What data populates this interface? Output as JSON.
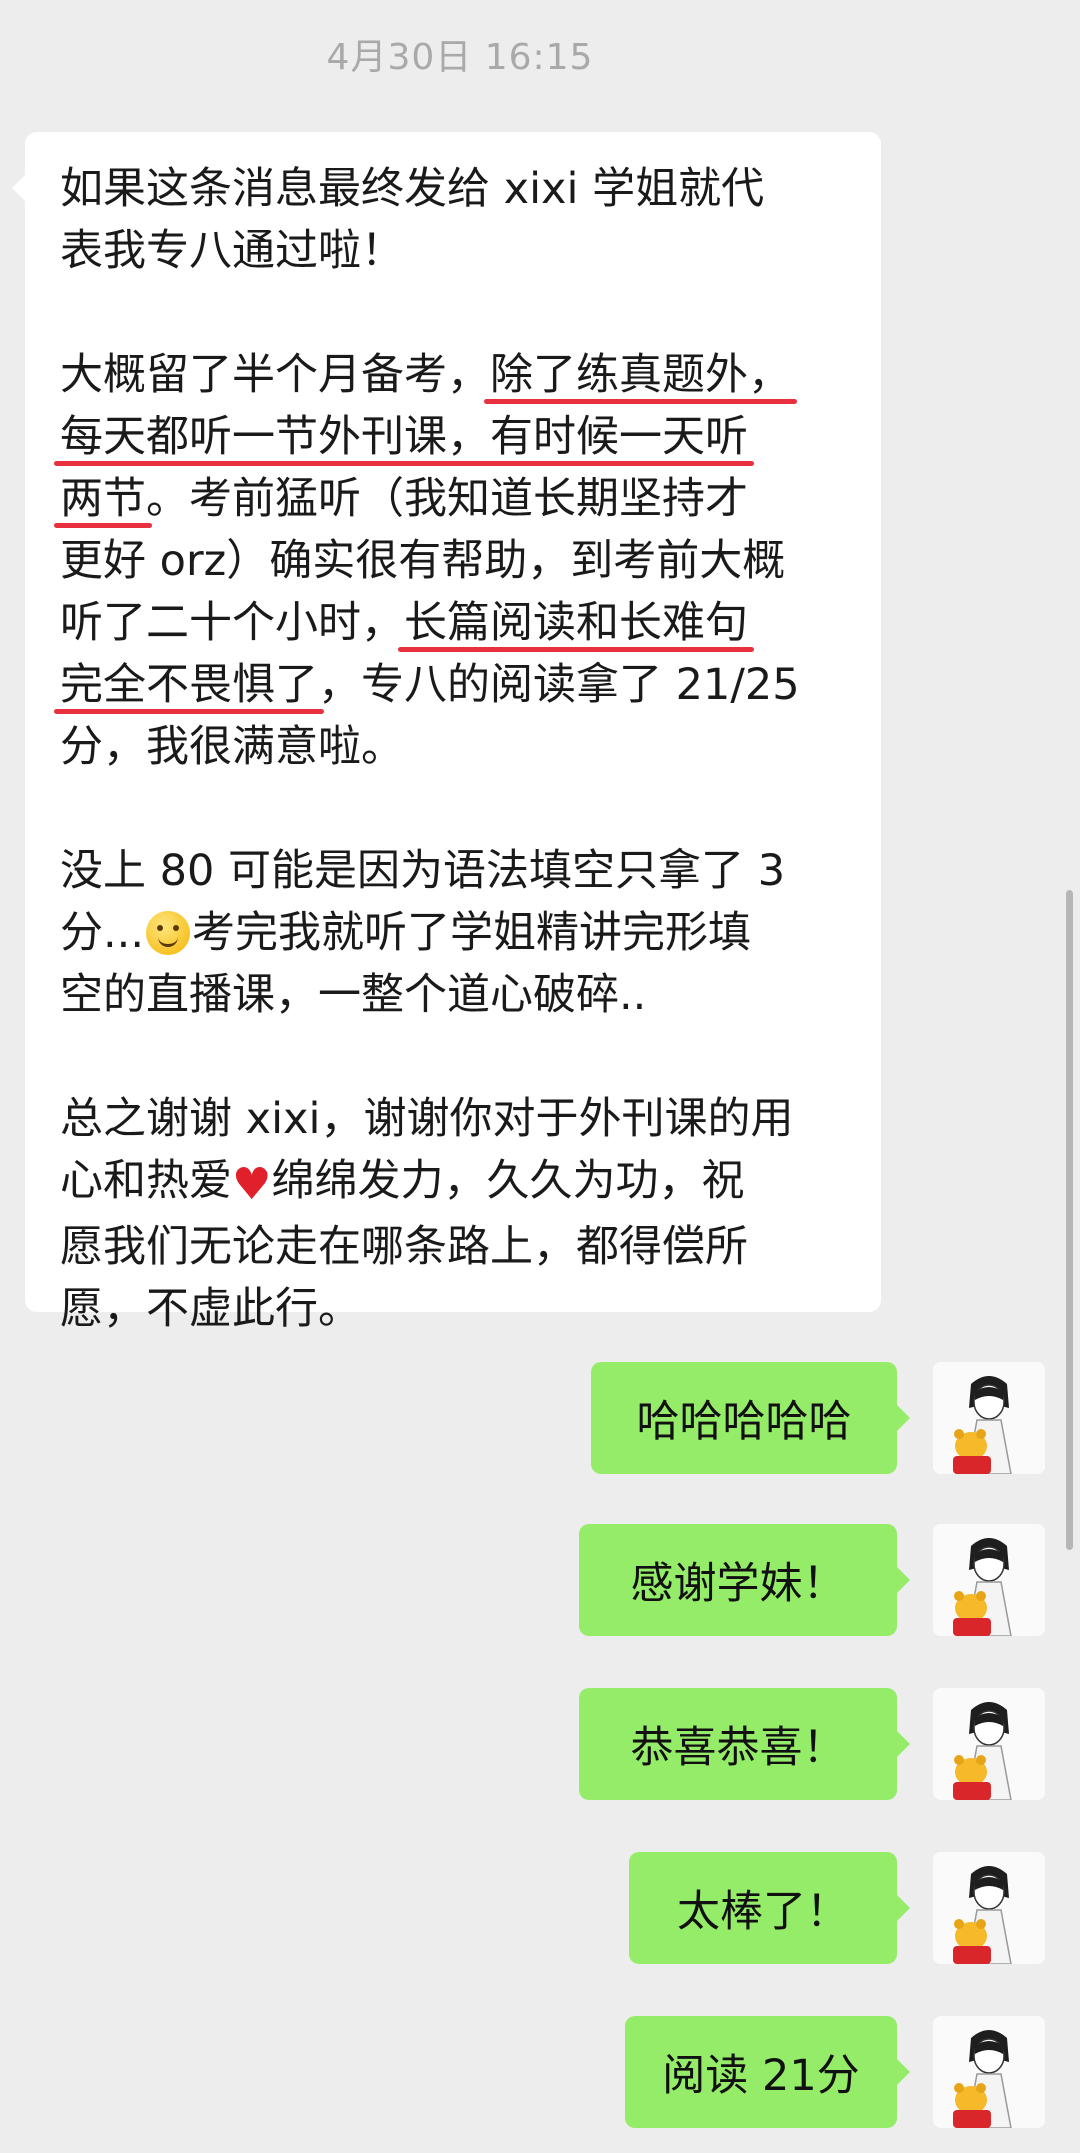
{
  "timestamp": "4月30日 16:15",
  "incoming": {
    "p1": {
      "l1": "如果这条消息最终发给 xixi 学姐就代",
      "l2": "表我专八通过啦！"
    },
    "p2": {
      "l1a": "大概留了半个月备考，",
      "l1b": "除了练真题外，",
      "l2": "每天都听一节外刊课，有时候一天听",
      "l3a": "两节",
      "l3b": "。考前猛听（我知道长期坚持才",
      "l4": "更好 orz）确实很有帮助，到考前大概",
      "l5a": "听了二十个小时，",
      "l5b": "长篇阅读和长难句",
      "l6a": "完全不畏惧了",
      "l6b": "，专八的阅读拿了 21/25",
      "l7": "分，我很满意啦。"
    },
    "p3": {
      "l1": "没上 80 可能是因为语法填空只拿了 3",
      "l2a": "分...",
      "l2b": "考完我就听了学姐精讲完形填",
      "l3": "空的直播课，一整个道心破碎.."
    },
    "p4": {
      "l1": "总之谢谢 xixi，谢谢你对于外刊课的用",
      "l2a": "心和热爱",
      "l2b": "绵绵发力，久久为功，祝",
      "l3": "愿我们无论走在哪条路上，都得偿所",
      "l4": "愿，不虚此行。"
    }
  },
  "outgoing": [
    {
      "text": "哈哈哈哈哈"
    },
    {
      "text": "感谢学妹！"
    },
    {
      "text": "恭喜恭喜！"
    },
    {
      "text": "太棒了！"
    },
    {
      "text": "阅读 21分"
    }
  ],
  "colors": {
    "background": "#ededed",
    "incoming_bubble": "#ffffff",
    "outgoing_bubble": "#95ec69",
    "underline": "#e8303f"
  },
  "icons": {
    "emoji_1": "slightly-smiling-face",
    "emoji_2": "red-heart",
    "avatar": "anime-boy-with-bear-avatar"
  }
}
